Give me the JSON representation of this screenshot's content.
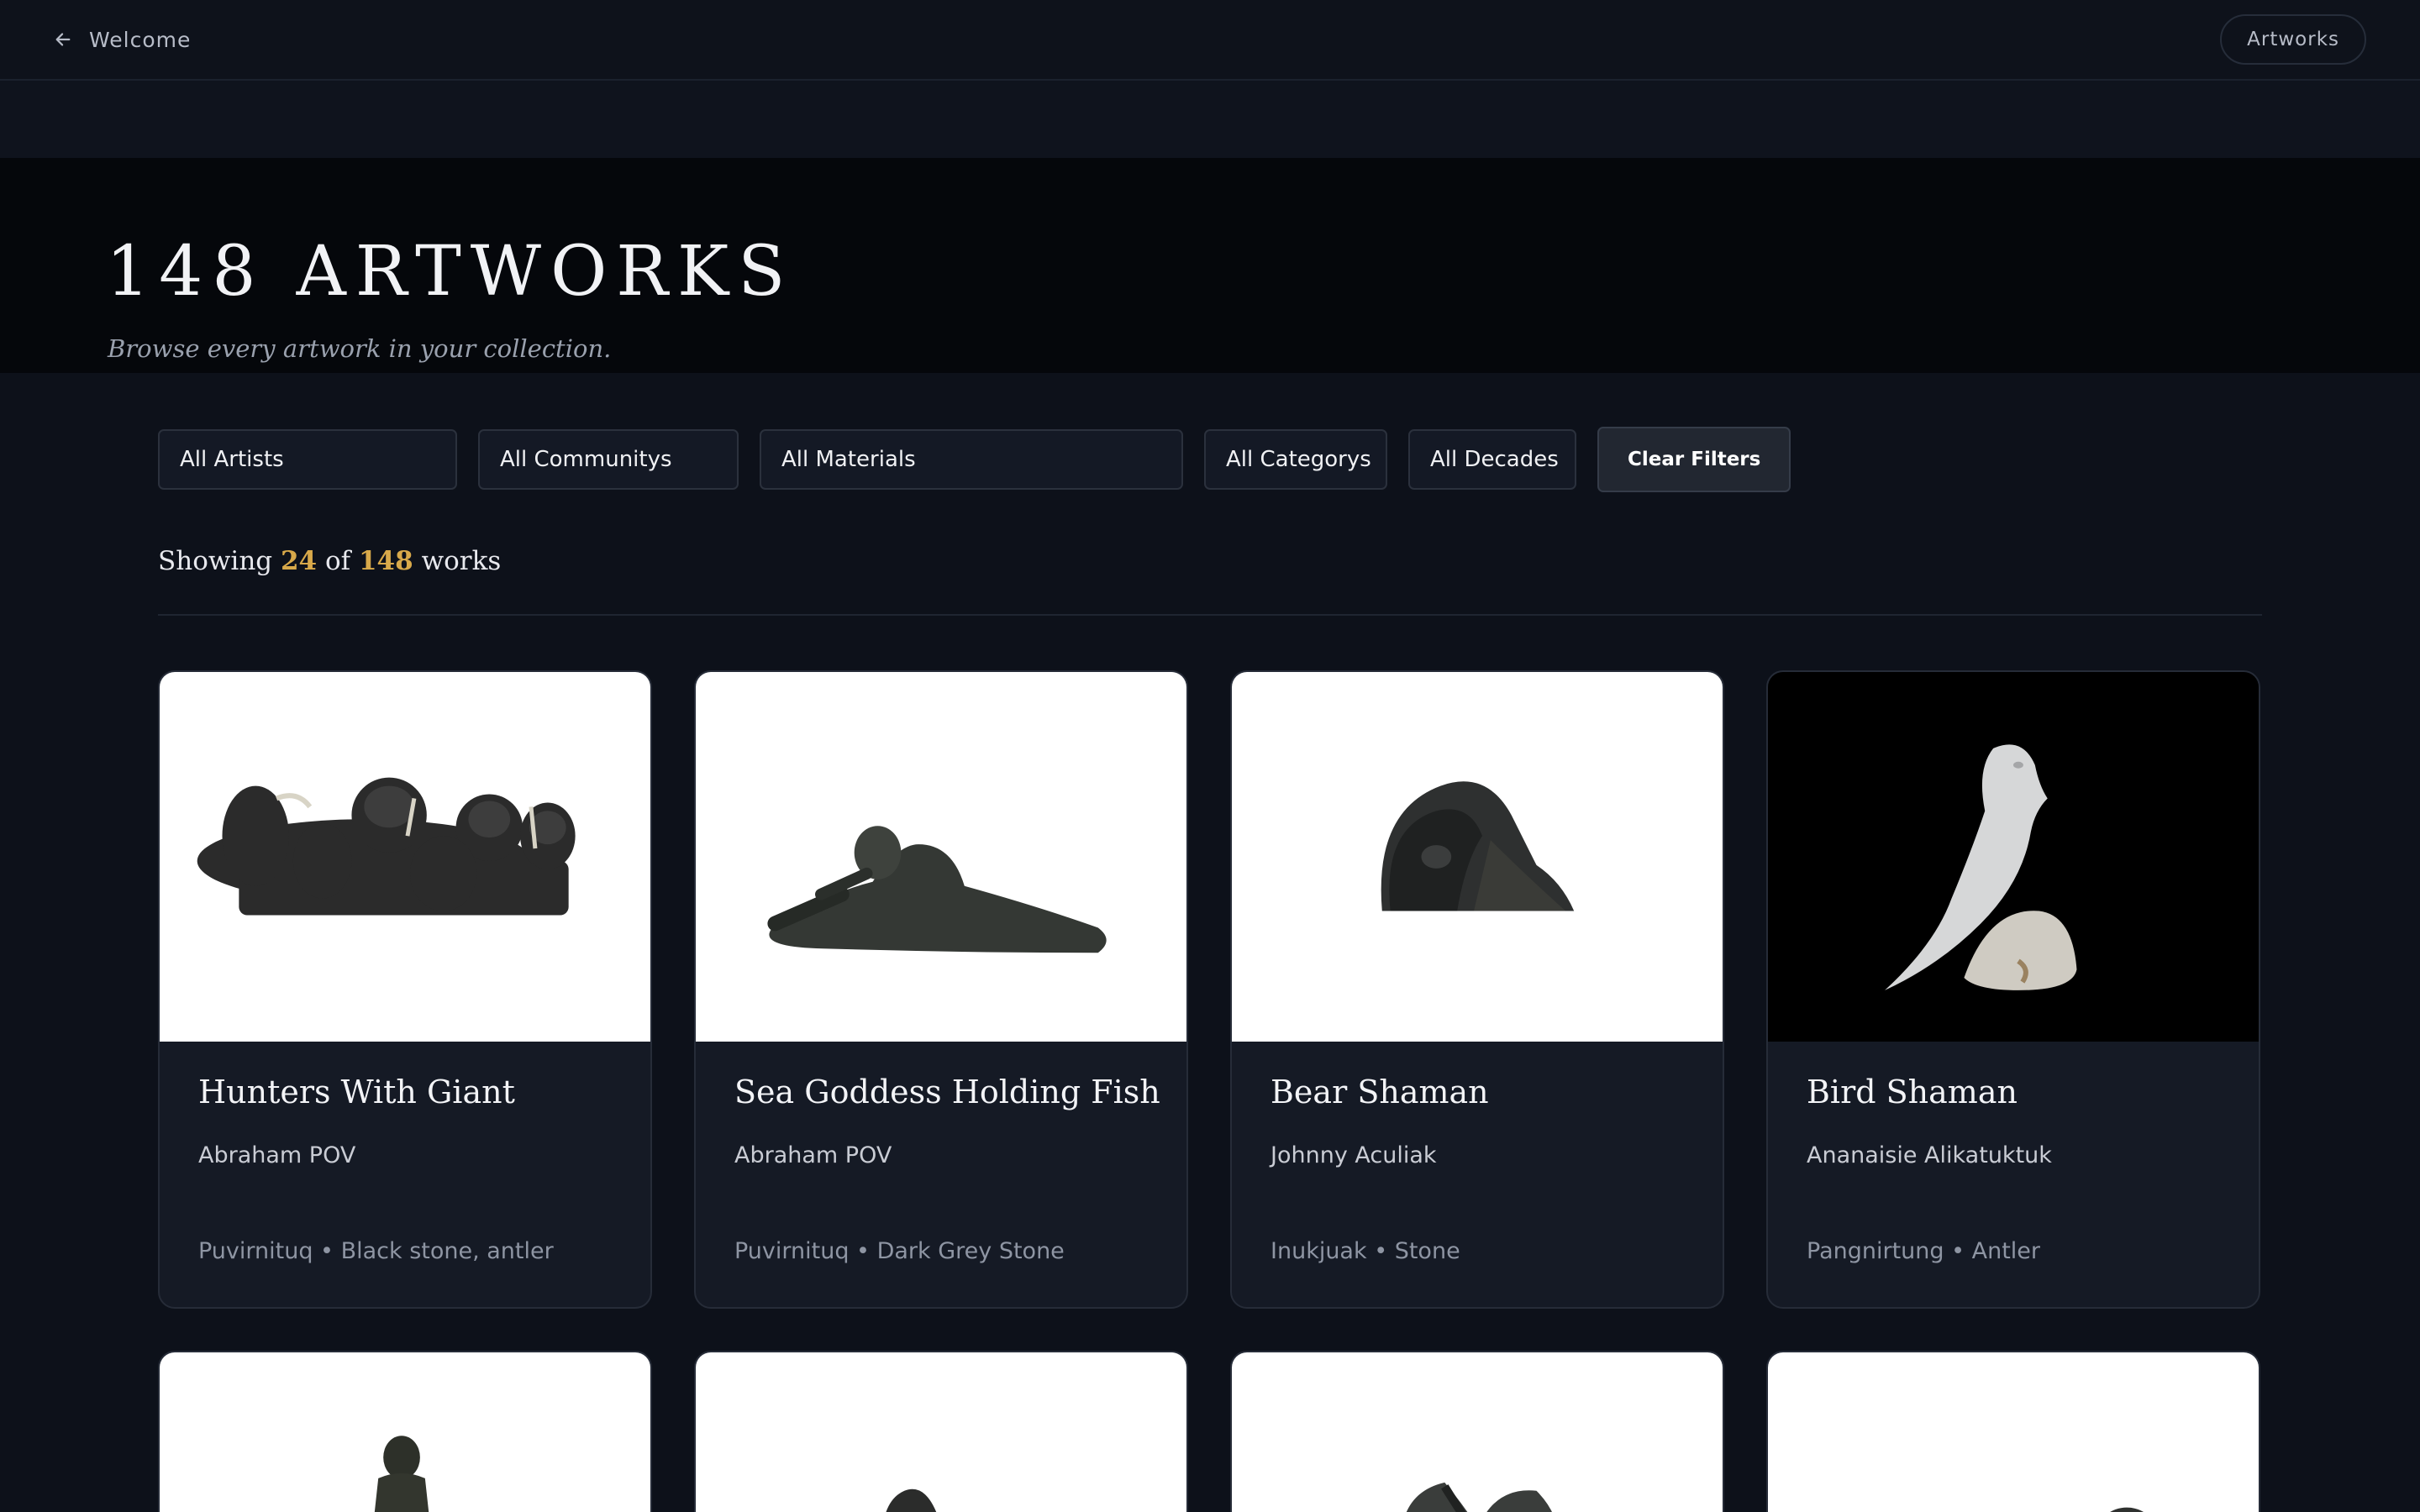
{
  "topbar": {
    "back_label": "Welcome",
    "nav_label": "Artworks"
  },
  "hero": {
    "title": "148 ARTWORKS",
    "subtitle": "Browse every artwork in your collection."
  },
  "filters": {
    "artists": "All Artists",
    "communities": "All Communitys",
    "materials": "All Materials",
    "categories": "All Categorys",
    "decades": "All Decades",
    "clear_label": "Clear Filters"
  },
  "results": {
    "prefix": "Showing",
    "shown": "24",
    "of": "of",
    "total": "148",
    "suffix": "works"
  },
  "artworks": [
    {
      "title": "Hunters With Giant",
      "artist": "Abraham POV",
      "meta": "Puvirnituq • Black stone, antler"
    },
    {
      "title": "Sea Goddess Holding Fish",
      "artist": "Abraham POV",
      "meta": "Puvirnituq • Dark Grey Stone"
    },
    {
      "title": "Bear Shaman",
      "artist": "Johnny Aculiak",
      "meta": "Inukjuak • Stone"
    },
    {
      "title": "Bird Shaman",
      "artist": "Ananaisie Alikatuktuk",
      "meta": "Pangnirtung • Antler"
    }
  ],
  "colors": {
    "accent": "#d8a94a",
    "background": "#0d111a",
    "card": "#151a25"
  }
}
